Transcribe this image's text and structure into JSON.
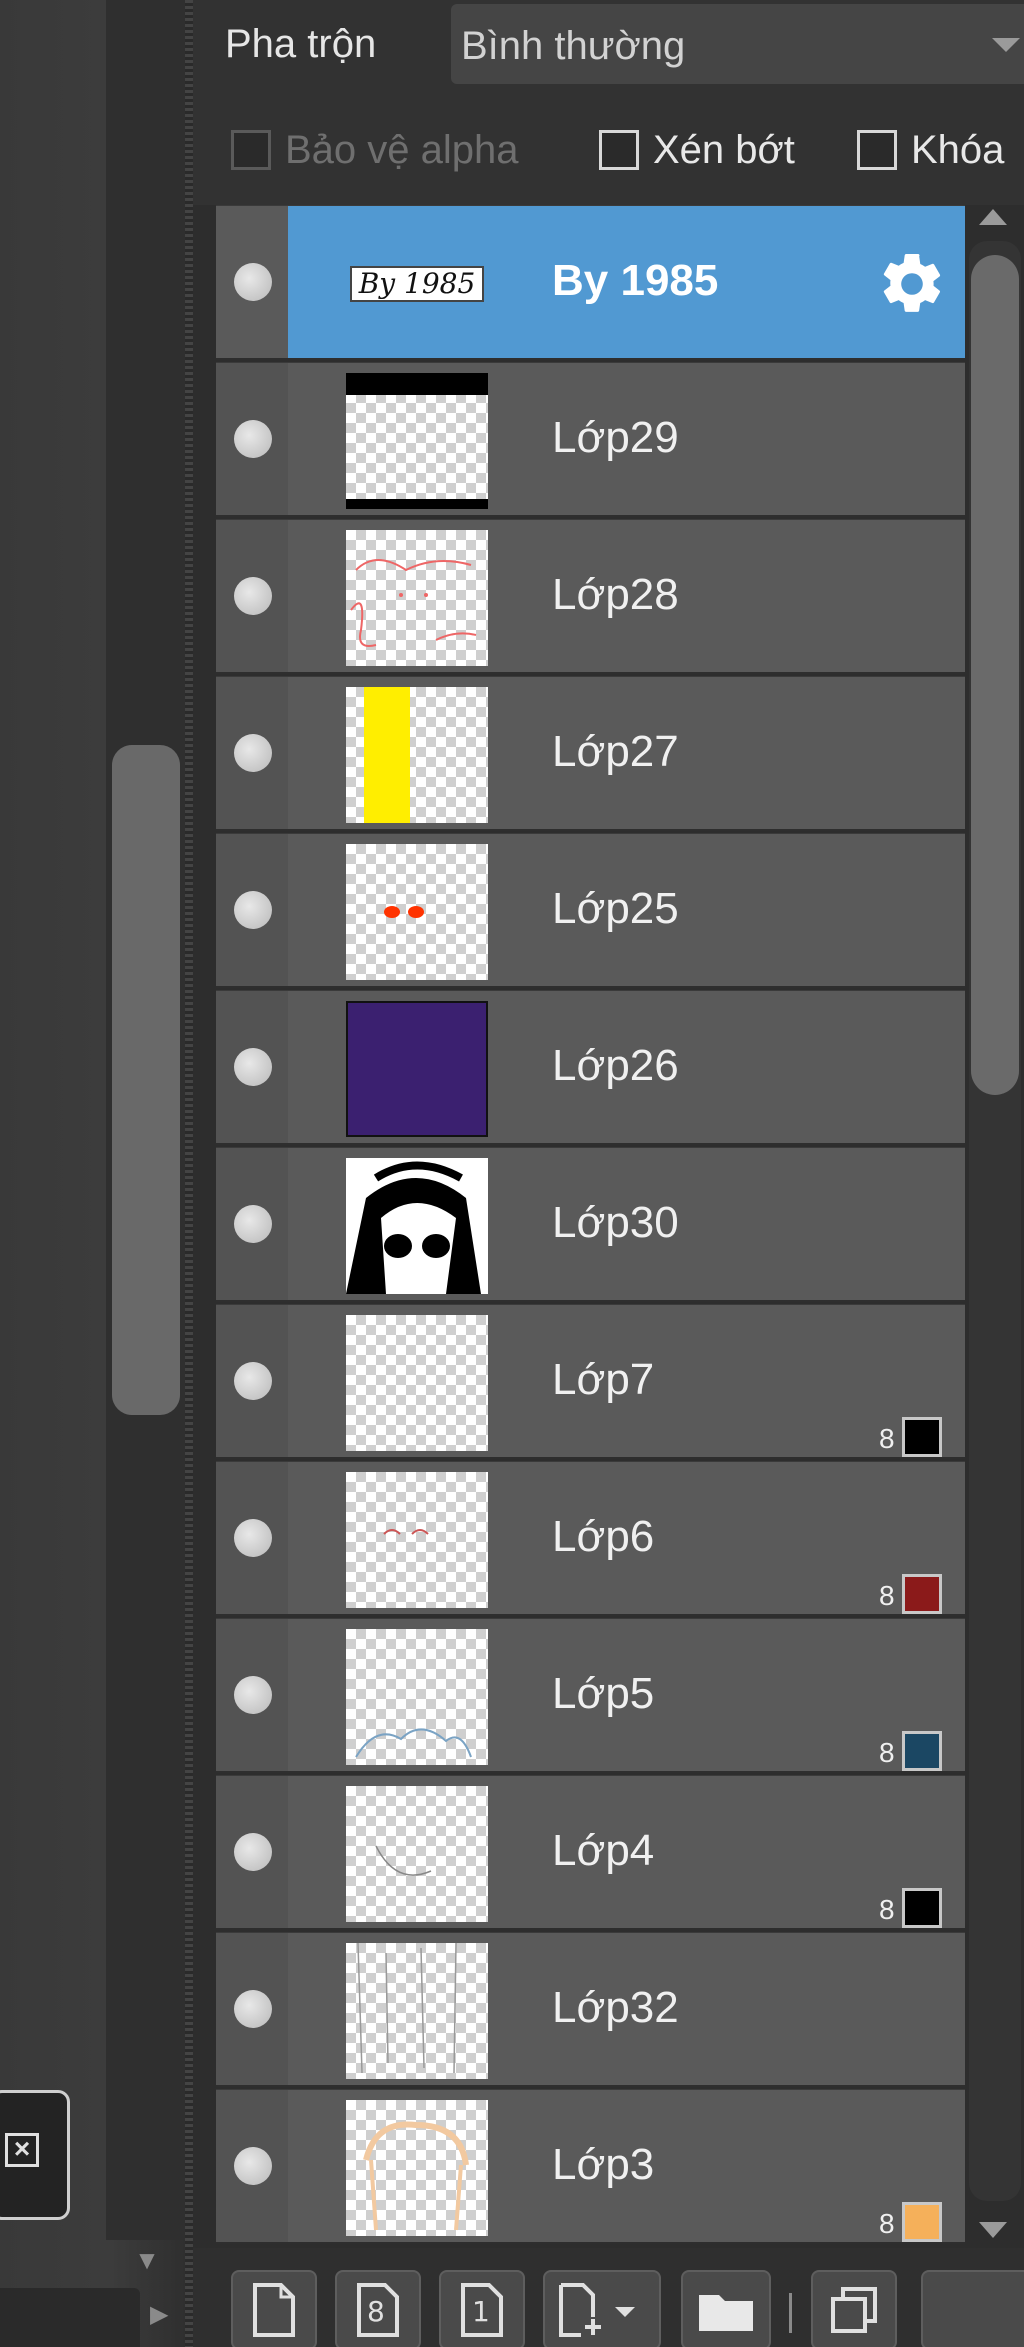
{
  "blend": {
    "label": "Pha trộn",
    "value": "Bình thường"
  },
  "options": {
    "protect_alpha": "Bảo vệ alpha",
    "clip": "Xén bớt",
    "lock": "Khóa"
  },
  "layers": [
    {
      "name": "By 1985",
      "selected": true,
      "thumb_text": "By 1985"
    },
    {
      "name": "Lớp29"
    },
    {
      "name": "Lớp28"
    },
    {
      "name": "Lớp27"
    },
    {
      "name": "Lớp25"
    },
    {
      "name": "Lớp26"
    },
    {
      "name": "Lớp30"
    },
    {
      "name": "Lớp7",
      "badge": "8",
      "badge_color": "#000000"
    },
    {
      "name": "Lớp6",
      "badge": "8",
      "badge_color": "#8b1a1a"
    },
    {
      "name": "Lớp5",
      "badge": "8",
      "badge_color": "#1b4763"
    },
    {
      "name": "Lớp4",
      "badge": "8",
      "badge_color": "#000000"
    },
    {
      "name": "Lớp32"
    },
    {
      "name": "Lớp3",
      "badge": "8",
      "badge_color": "#f5b05a"
    }
  ],
  "toolbar": {
    "new_layer_8bit": "8",
    "new_layer_1bit": "1"
  },
  "colors": {
    "selected_row": "#5199d2",
    "row": "#5a5a5a",
    "panel_bg": "#2d2d2d"
  }
}
